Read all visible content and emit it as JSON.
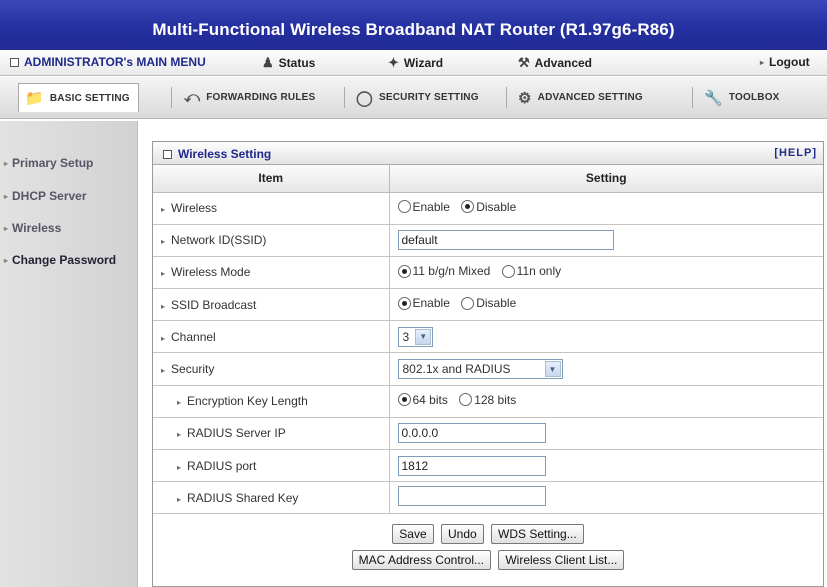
{
  "banner": {
    "title": "Multi-Functional Wireless Broadband NAT Router (R1.97g6-R86)"
  },
  "main_menu": {
    "admin": "ADMINISTRATOR's MAIN MENU",
    "status": "Status",
    "wizard": "Wizard",
    "advanced": "Advanced",
    "logout": "Logout"
  },
  "tabs": {
    "basic": "BASIC SETTING",
    "forwarding": "FORWARDING RULES",
    "security": "SECURITY SETTING",
    "advanced": "ADVANCED SETTING",
    "toolbox": "TOOLBOX"
  },
  "sidebar": {
    "primary": "Primary Setup",
    "dhcp": "DHCP Server",
    "wireless": "Wireless",
    "password": "Change Password"
  },
  "panel": {
    "title": "Wireless Setting",
    "help": "[HELP]",
    "col_item": "Item",
    "col_setting": "Setting"
  },
  "rows": {
    "wireless": {
      "label": "Wireless",
      "opt1": "Enable",
      "opt2": "Disable",
      "selected": "Disable"
    },
    "ssid": {
      "label": "Network ID(SSID)",
      "value": "default"
    },
    "mode": {
      "label": "Wireless Mode",
      "opt1": "11 b/g/n Mixed",
      "opt2": "11n only",
      "selected": "11 b/g/n Mixed"
    },
    "broadcast": {
      "label": "SSID Broadcast",
      "opt1": "Enable",
      "opt2": "Disable",
      "selected": "Enable"
    },
    "channel": {
      "label": "Channel",
      "value": "3"
    },
    "security": {
      "label": "Security",
      "value": "802.1x and RADIUS"
    },
    "keylen": {
      "label": "Encryption Key Length",
      "opt1": "64 bits",
      "opt2": "128 bits",
      "selected": "64 bits"
    },
    "radius_ip": {
      "label": "RADIUS Server IP",
      "value": "0.0.0.0"
    },
    "radius_port": {
      "label": "RADIUS port",
      "value": "1812"
    },
    "radius_key": {
      "label": "RADIUS Shared Key",
      "value": ""
    }
  },
  "buttons": {
    "save": "Save",
    "undo": "Undo",
    "wds": "WDS Setting...",
    "mac": "MAC Address Control...",
    "clients": "Wireless Client List..."
  }
}
